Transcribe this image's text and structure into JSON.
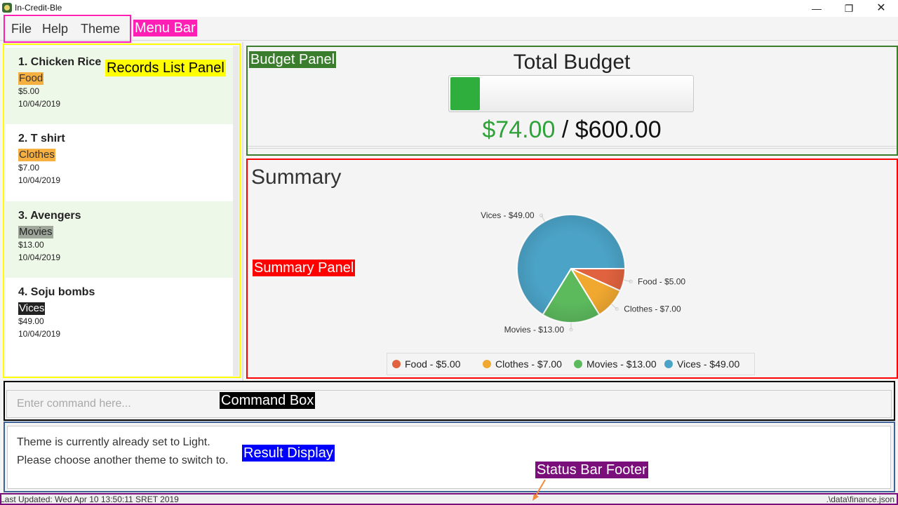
{
  "window": {
    "title": "In-Credit-Ble",
    "minimize_glyph": "—",
    "maximize_glyph": "❐",
    "close_glyph": "✕"
  },
  "menu": {
    "items": [
      "File",
      "Help",
      "Theme"
    ]
  },
  "records": [
    {
      "title": "1.  Chicken Rice",
      "category": "Food",
      "amount": "$5.00",
      "date": "10/04/2019"
    },
    {
      "title": "2.  T shirt",
      "category": "Clothes",
      "amount": "$7.00",
      "date": "10/04/2019"
    },
    {
      "title": "3.  Avengers",
      "category": "Movies",
      "amount": "$13.00",
      "date": "10/04/2019"
    },
    {
      "title": "4.  Soju bombs",
      "category": "Vices",
      "amount": "$49.00",
      "date": "10/04/2019"
    }
  ],
  "budget": {
    "title": "Total Budget",
    "spent": "$74.00",
    "separator": " / ",
    "total": "$600.00",
    "fill_fraction": 0.1233
  },
  "summary": {
    "title": "Summary"
  },
  "chart_data": {
    "type": "pie",
    "slices": [
      {
        "label": "Food - $5.00",
        "value": 5.0,
        "color": "#e0623e"
      },
      {
        "label": "Clothes - $7.00",
        "value": 7.0,
        "color": "#f0a830"
      },
      {
        "label": "Movies - $13.00",
        "value": 13.0,
        "color": "#5cb95c"
      },
      {
        "label": "Vices - $49.00",
        "value": 49.0,
        "color": "#4ba3c7"
      }
    ],
    "legend": [
      {
        "label": "Food - $5.00",
        "color": "#e0623e"
      },
      {
        "label": "Clothes - $7.00",
        "color": "#f0a830"
      },
      {
        "label": "Movies - $13.00",
        "color": "#5cb95c"
      },
      {
        "label": "Vices - $49.00",
        "color": "#4ba3c7"
      }
    ],
    "legend_position": "bottom"
  },
  "command": {
    "placeholder": "Enter command here..."
  },
  "result": {
    "line1": "Theme is currently already set to Light.",
    "line2": "Please choose another theme to switch to."
  },
  "status": {
    "last_updated": "Last Updated: Wed Apr 10 13:50:11 SRET 2019",
    "file_path": ".\\data\\finance.json"
  },
  "annotations": {
    "menu_bar": "Menu Bar",
    "records_list_panel": "Records List Panel",
    "budget_panel": "Budget Panel",
    "summary_panel": "Summary Panel",
    "command_box": "Command Box",
    "result_display": "Result Display",
    "status_bar_footer": "Status Bar Footer"
  },
  "colors": {
    "menu_annotation": "#ff1fb4",
    "records_annotation": "#ffff00",
    "budget_annotation": "#3a7d2c",
    "summary_annotation": "#ff0000",
    "command_annotation": "#000000",
    "result_annotation": "#0000ff",
    "result_box_border": "#3f6394",
    "status_annotation": "#7a0e7a",
    "arrow": "#f08a3c"
  }
}
